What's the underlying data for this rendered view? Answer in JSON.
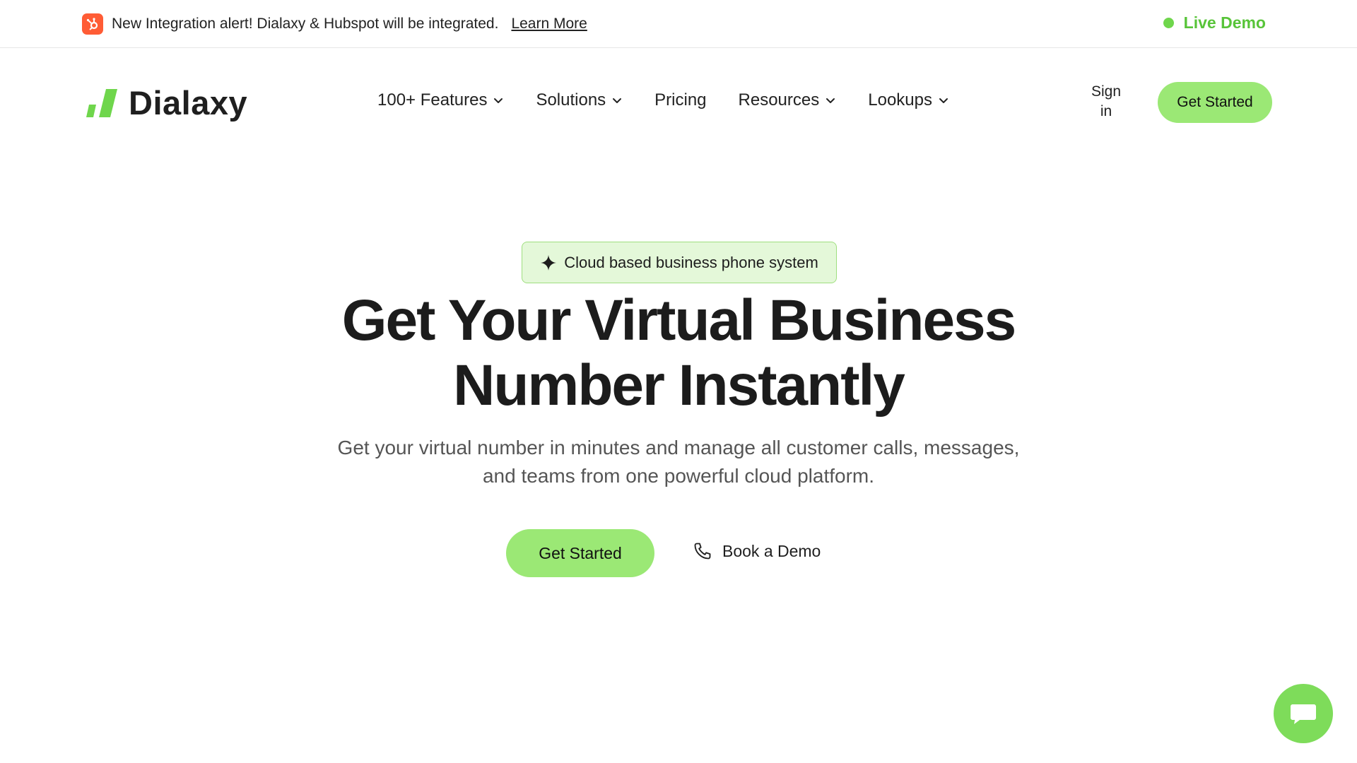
{
  "announcement": {
    "text": "New Integration alert! Dialaxy & Hubspot will be integrated.",
    "link": "Learn More",
    "icon": "hubspot-icon",
    "live_demo": "Live Demo"
  },
  "header": {
    "logo_text": "Dialaxy",
    "nav": [
      {
        "label": "100+ Features",
        "dropdown": true
      },
      {
        "label": "Solutions",
        "dropdown": true
      },
      {
        "label": "Pricing",
        "dropdown": false
      },
      {
        "label": "Resources",
        "dropdown": true
      },
      {
        "label": "Lookups",
        "dropdown": true
      }
    ],
    "sign_in_line1": "Sign",
    "sign_in_line2": "in",
    "cta": "Get Started"
  },
  "hero": {
    "badge": "Cloud based business phone system",
    "title_line1": "Get Your Virtual Business",
    "title_line2": "Number Instantly",
    "subtitle_line1": "Get your virtual number in minutes and manage all customer calls, messages,",
    "subtitle_line2": "and teams from one powerful cloud platform.",
    "primary_cta": "Get Started",
    "secondary_cta": "Book a Demo"
  },
  "colors": {
    "brand_green": "#9be875",
    "live_green": "#58c439",
    "hubspot_orange": "#ff5c35",
    "badge_bg": "#e4f8d9"
  }
}
